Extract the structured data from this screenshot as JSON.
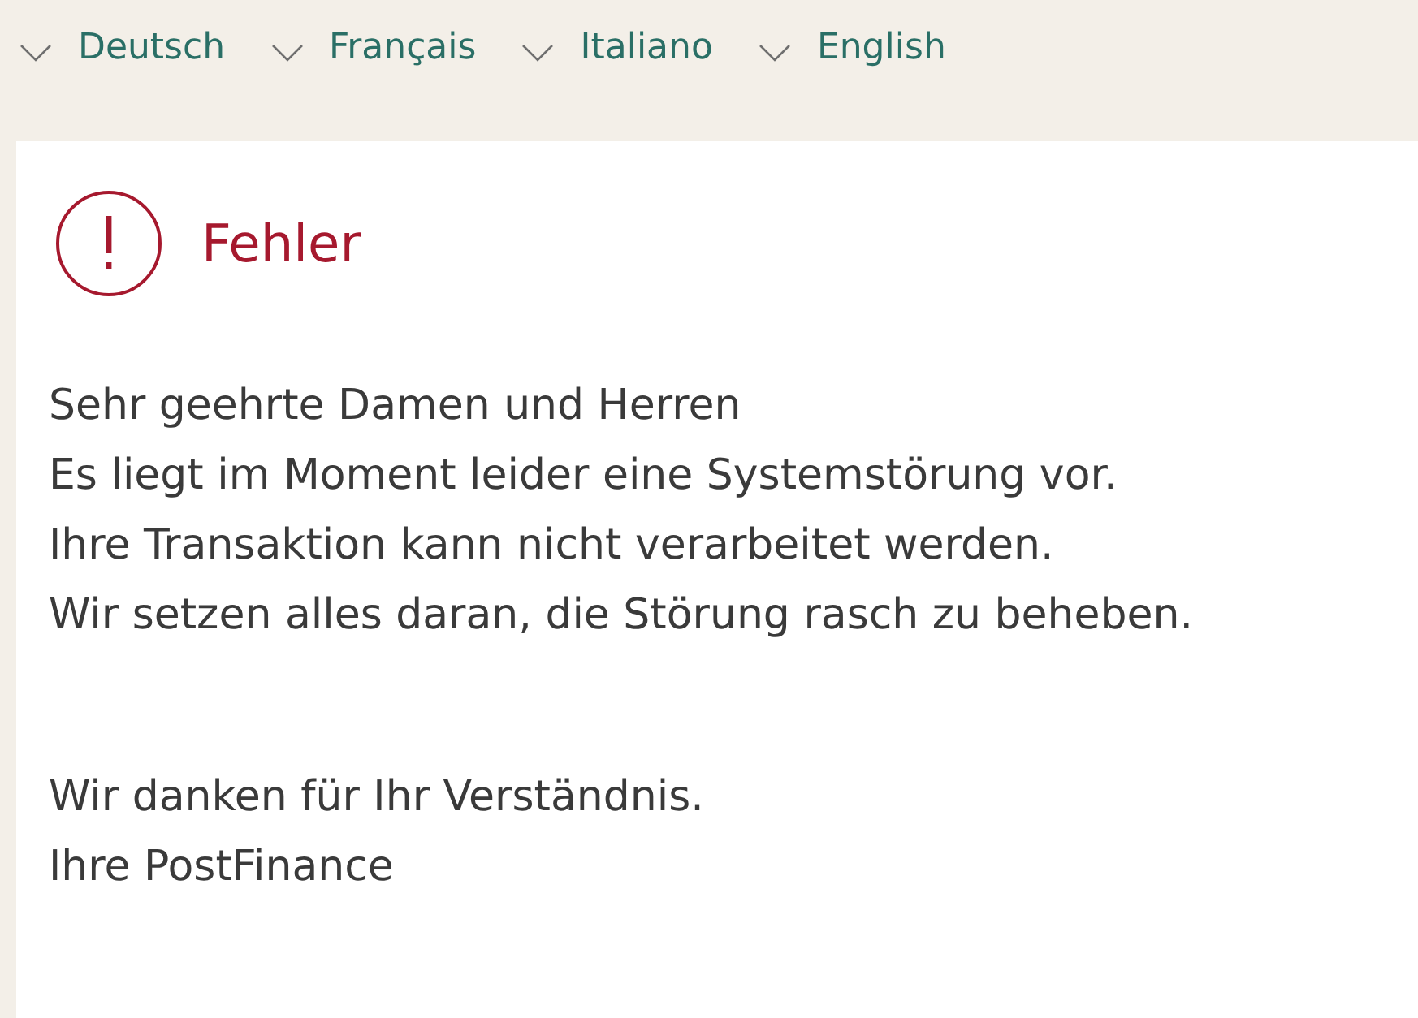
{
  "languages": [
    {
      "label": "Deutsch"
    },
    {
      "label": "Français"
    },
    {
      "label": "Italiano"
    },
    {
      "label": "English"
    }
  ],
  "message": {
    "kind": "error",
    "title": "Fehler",
    "paragraphs": [
      [
        "Sehr geehrte Damen und Herren",
        "Es liegt im Moment leider eine Systemstörung vor.",
        "Ihre Transaktion kann nicht verarbeitet werden.",
        "Wir setzen alles daran, die Störung rasch zu beheben."
      ],
      [
        "Wir danken für Ihr Verständnis.",
        "Ihre PostFinance"
      ]
    ]
  }
}
